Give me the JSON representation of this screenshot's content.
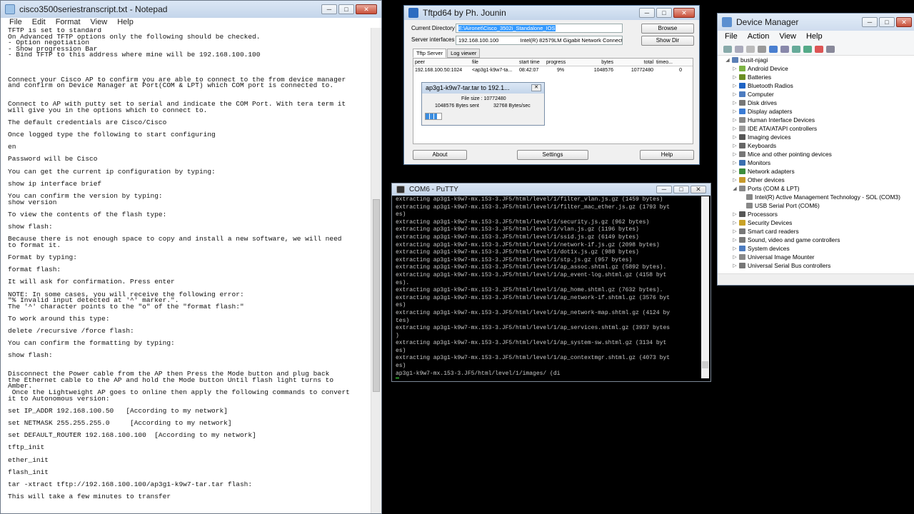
{
  "notepad": {
    "title": "cisco3500seriestranscript.txt - Notepad",
    "menu": [
      "File",
      "Edit",
      "Format",
      "View",
      "Help"
    ],
    "lines": [
      "TFTP is set to standard",
      "On Advanced TFTP options only the following should be checked.",
      "- Option negotiation",
      "- Show progression Bar",
      "- Bind TFTP to this address where mine will be 192.168.100.100",
      "",
      "",
      "",
      "Connect your Cisco AP to confirm you are able to connect to the from device manager",
      "and confirm on Device Manager at Port(COM & LPT) which COM port is connected to.",
      "",
      "",
      "Connect to AP with putty set to serial and indicate the COM Port. With tera term it",
      "will give you in the options which to connect to.",
      "",
      "The default credentials are Cisco/Cisco",
      "",
      "Once logged type the following to start configuring",
      "",
      "en",
      "",
      "Password will be Cisco",
      "",
      "You can get the current ip configuration by typing:",
      "",
      "show ip interface brief",
      "",
      "You can confirm the version by typing:",
      "show version",
      "",
      "To view the contents of the flash type:",
      "",
      "show flash:",
      "",
      "Because there is not enough space to copy and install a new software, we will need",
      "to format it.",
      "",
      "Format by typing:",
      "",
      "format flash:",
      "",
      "It will ask for confirmation. Press enter",
      "",
      "NOTE: In some cases, you will receive the following error:",
      "\"% Invalid input detected at '^' marker.\".",
      "The '^' character points to the \"o\" of the \"format flash:\"",
      "",
      "To work around this type:",
      "",
      "delete /recursive /force flash:",
      "",
      "You can confirm the formatting by typing:",
      "",
      "show flash:",
      "",
      "",
      "Disconnect the Power cable from the AP then Press the Mode button and plug back",
      "the Ethernet cable to the AP and hold the Mode button Until flash light turns to",
      "Amber.",
      " Once the Lightweight AP goes to online then apply the following commands to convert",
      "it to Autonomous version:",
      "",
      "set IP_ADDR 192.168.100.50   [According to my network]",
      "",
      "set NETMASK 255.255.255.0     [According to my network]",
      "",
      "set DEFAULT_ROUTER 192.168.100.100  [According to my network]",
      "",
      "tftp_init",
      "",
      "ether_init",
      "",
      "flash_init",
      "",
      "tar -xtract tftp://192.168.100.100/ap3g1-k9w7-tar.tar flash:",
      "",
      "This will take a few minutes to transfer"
    ],
    "selected_line_index": 75
  },
  "tftpd": {
    "title": "Tftpd64 by Ph. Jounin",
    "current_directory_label": "Current Directory",
    "current_directory_value": "E:\\Aironet\\Cisco_3502i_Standalone_IOS",
    "server_interfaces_label": "Server interfaces",
    "server_ip": "192.168.100.100",
    "interface_name": "Intel(R) 82579LM Gigabit Network Connect",
    "browse_label": "Browse",
    "show_dir_label": "Show Dir",
    "tabs": [
      "Tftp Server",
      "Log viewer"
    ],
    "columns": [
      "peer",
      "file",
      "start time",
      "progress",
      "bytes",
      "total",
      "timeo..."
    ],
    "rows": [
      [
        "192.168.100.50:1024",
        "<ap3g1-k9w7-ta...",
        "08:42:07",
        "9%",
        "1048576",
        "10772480",
        "0"
      ]
    ],
    "popup": {
      "title": "ap3g1-k9w7-tar.tar to 192.1...",
      "file_size": "File size : 10772480",
      "bytes_sent": "1048576 Bytes sent",
      "rate": "32768 Bytes/sec",
      "progress_fraction": 0.09
    },
    "about_label": "About",
    "settings_label": "Settings",
    "help_label": "Help"
  },
  "putty": {
    "title": "COM6 - PuTTY",
    "lines": [
      "extracting ap3g1-k9w7-mx.153-3.JF5/html/level/1/filter_vlan.js.gz (1459 bytes)",
      "extracting ap3g1-k9w7-mx.153-3.JF5/html/level/1/filter_mac_ether.js.gz (1793 byt",
      "es)",
      "extracting ap3g1-k9w7-mx.153-3.JF5/html/level/1/security.js.gz (962 bytes)",
      "extracting ap3g1-k9w7-mx.153-3.JF5/html/level/1/vlan.js.gz (1196 bytes)",
      "extracting ap3g1-k9w7-mx.153-3.JF5/html/level/1/ssid.js.gz (6149 bytes)",
      "extracting ap3g1-k9w7-mx.153-3.JF5/html/level/1/network-if.js.gz (2098 bytes)",
      "extracting ap3g1-k9w7-mx.153-3.JF5/html/level/1/dot1x.js.gz (988 bytes)",
      "extracting ap3g1-k9w7-mx.153-3.JF5/html/level/1/stp.js.gz (957 bytes)",
      "extracting ap3g1-k9w7-mx.153-3.JF5/html/level/1/ap_assoc.shtml.gz (5892 bytes).",
      "extracting ap3g1-k9w7-mx.153-3.JF5/html/level/1/ap_event-log.shtml.gz (4158 byt",
      "es).",
      "extracting ap3g1-k9w7-mx.153-3.JF5/html/level/1/ap_home.shtml.gz (7632 bytes).",
      "extracting ap3g1-k9w7-mx.153-3.JF5/html/level/1/ap_network-if.shtml.gz (3576 byt",
      "es)",
      "extracting ap3g1-k9w7-mx.153-3.JF5/html/level/1/ap_network-map.shtml.gz (4124 by",
      "tes)",
      "extracting ap3g1-k9w7-mx.153-3.JF5/html/level/1/ap_services.shtml.gz (3937 bytes",
      ")",
      "extracting ap3g1-k9w7-mx.153-3.JF5/html/level/1/ap_system-sw.shtml.gz (3134 byt",
      "es)",
      "extracting ap3g1-k9w7-mx.153-3.JF5/html/level/1/ap_contextmgr.shtml.gz (4073 byt",
      "es)"
    ],
    "prompt_line": "ap3g1-k9w7-mx.153-3.JF5/html/level/1/images/ (di"
  },
  "devmgr": {
    "title": "Device Manager",
    "menu": [
      "File",
      "Action",
      "View",
      "Help"
    ],
    "tree": [
      {
        "label": "busit-njagi",
        "level": 0,
        "exp": "◢",
        "icon": "computer-icon",
        "color": "#5b7fb5"
      },
      {
        "label": "Android Device",
        "level": 1,
        "exp": "▷",
        "icon": "android-icon",
        "color": "#7cb342"
      },
      {
        "label": "Batteries",
        "level": 1,
        "exp": "▷",
        "icon": "battery-icon",
        "color": "#6b8e23"
      },
      {
        "label": "Bluetooth Radios",
        "level": 1,
        "exp": "▷",
        "icon": "bluetooth-icon",
        "color": "#1e63c4"
      },
      {
        "label": "Computer",
        "level": 1,
        "exp": "▷",
        "icon": "computer-icon",
        "color": "#4d7cc0"
      },
      {
        "label": "Disk drives",
        "level": 1,
        "exp": "▷",
        "icon": "disk-icon",
        "color": "#777"
      },
      {
        "label": "Display adapters",
        "level": 1,
        "exp": "▷",
        "icon": "display-icon",
        "color": "#3a7bd5"
      },
      {
        "label": "Human Interface Devices",
        "level": 1,
        "exp": "▷",
        "icon": "hid-icon",
        "color": "#888"
      },
      {
        "label": "IDE ATA/ATAPI controllers",
        "level": 1,
        "exp": "▷",
        "icon": "ide-icon",
        "color": "#999"
      },
      {
        "label": "Imaging devices",
        "level": 1,
        "exp": "▷",
        "icon": "camera-icon",
        "color": "#555"
      },
      {
        "label": "Keyboards",
        "level": 1,
        "exp": "▷",
        "icon": "keyboard-icon",
        "color": "#666"
      },
      {
        "label": "Mice and other pointing devices",
        "level": 1,
        "exp": "▷",
        "icon": "mouse-icon",
        "color": "#777"
      },
      {
        "label": "Monitors",
        "level": 1,
        "exp": "▷",
        "icon": "monitor-icon",
        "color": "#3a6fb0"
      },
      {
        "label": "Network adapters",
        "level": 1,
        "exp": "▷",
        "icon": "network-icon",
        "color": "#3c8d3c"
      },
      {
        "label": "Other devices",
        "level": 1,
        "exp": "▷",
        "icon": "unknown-device-icon",
        "color": "#c79a2c"
      },
      {
        "label": "Ports (COM & LPT)",
        "level": 1,
        "exp": "◢",
        "icon": "port-icon",
        "color": "#888"
      },
      {
        "label": "Intel(R) Active Management Technology - SOL (COM3)",
        "level": 2,
        "exp": "",
        "icon": "port-icon",
        "color": "#888"
      },
      {
        "label": "USB Serial Port (COM6)",
        "level": 2,
        "exp": "",
        "icon": "port-icon",
        "color": "#888"
      },
      {
        "label": "Processors",
        "level": 1,
        "exp": "▷",
        "icon": "cpu-icon",
        "color": "#555"
      },
      {
        "label": "Security Devices",
        "level": 1,
        "exp": "▷",
        "icon": "security-icon",
        "color": "#c9a227"
      },
      {
        "label": "Smart card readers",
        "level": 1,
        "exp": "▷",
        "icon": "smartcard-icon",
        "color": "#777"
      },
      {
        "label": "Sound, video and game controllers",
        "level": 1,
        "exp": "▷",
        "icon": "sound-icon",
        "color": "#777"
      },
      {
        "label": "System devices",
        "level": 1,
        "exp": "▷",
        "icon": "system-icon",
        "color": "#4d7cc0"
      },
      {
        "label": "Universal Image Mounter",
        "level": 1,
        "exp": "▷",
        "icon": "image-mounter-icon",
        "color": "#888"
      },
      {
        "label": "Universal Serial Bus controllers",
        "level": 1,
        "exp": "▷",
        "icon": "usb-icon",
        "color": "#777"
      }
    ]
  }
}
